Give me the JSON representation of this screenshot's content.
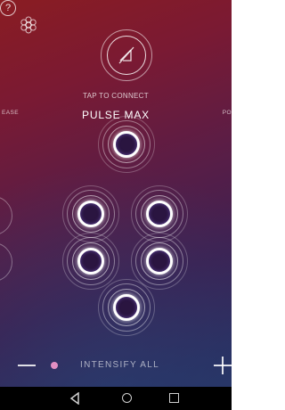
{
  "header": {
    "connect_label": "TAP TO CONNECT",
    "device_name": "PULSE MAX",
    "left_peek": "EASE",
    "right_peek": "PO",
    "help_glyph": "?",
    "left_icon": "settings-flower-icon",
    "connect_icon": "bluetooth-disabled-icon"
  },
  "pads": [
    {
      "name": "pad-top"
    },
    {
      "name": "pad-upper-left"
    },
    {
      "name": "pad-upper-right"
    },
    {
      "name": "pad-lower-left"
    },
    {
      "name": "pad-lower-right"
    },
    {
      "name": "pad-bottom"
    }
  ],
  "footer": {
    "intensify_label": "INTENSIFY ALL"
  },
  "colors": {
    "accent": "#e28fc3",
    "pad_core": "#2a1540",
    "nav_bar": "#000000"
  }
}
